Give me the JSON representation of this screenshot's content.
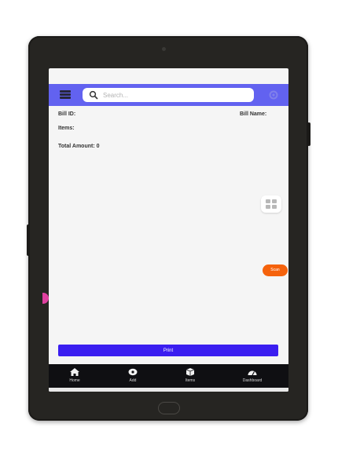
{
  "header": {
    "search_placeholder": "Search..."
  },
  "bill": {
    "bill_id_label": "Bill ID:",
    "bill_name_label": "Bill Name:",
    "items_label": "Items:",
    "total_amount_label": "Total Amount: 0"
  },
  "floating": {
    "orange_pill_label": "Scan"
  },
  "actions": {
    "print_label": "Print"
  },
  "bottom_nav": {
    "items": [
      {
        "label": "Home",
        "icon": "home-icon"
      },
      {
        "label": "Add",
        "icon": "add-icon"
      },
      {
        "label": "Items",
        "icon": "items-icon"
      },
      {
        "label": "Dashboard",
        "icon": "dashboard-icon"
      }
    ]
  },
  "colors": {
    "appbar": "#6262f0",
    "print_button": "#3b1ef0",
    "bottom_nav": "#0f0f12",
    "accent_orange": "#f5620c",
    "device_frame": "#262522"
  }
}
